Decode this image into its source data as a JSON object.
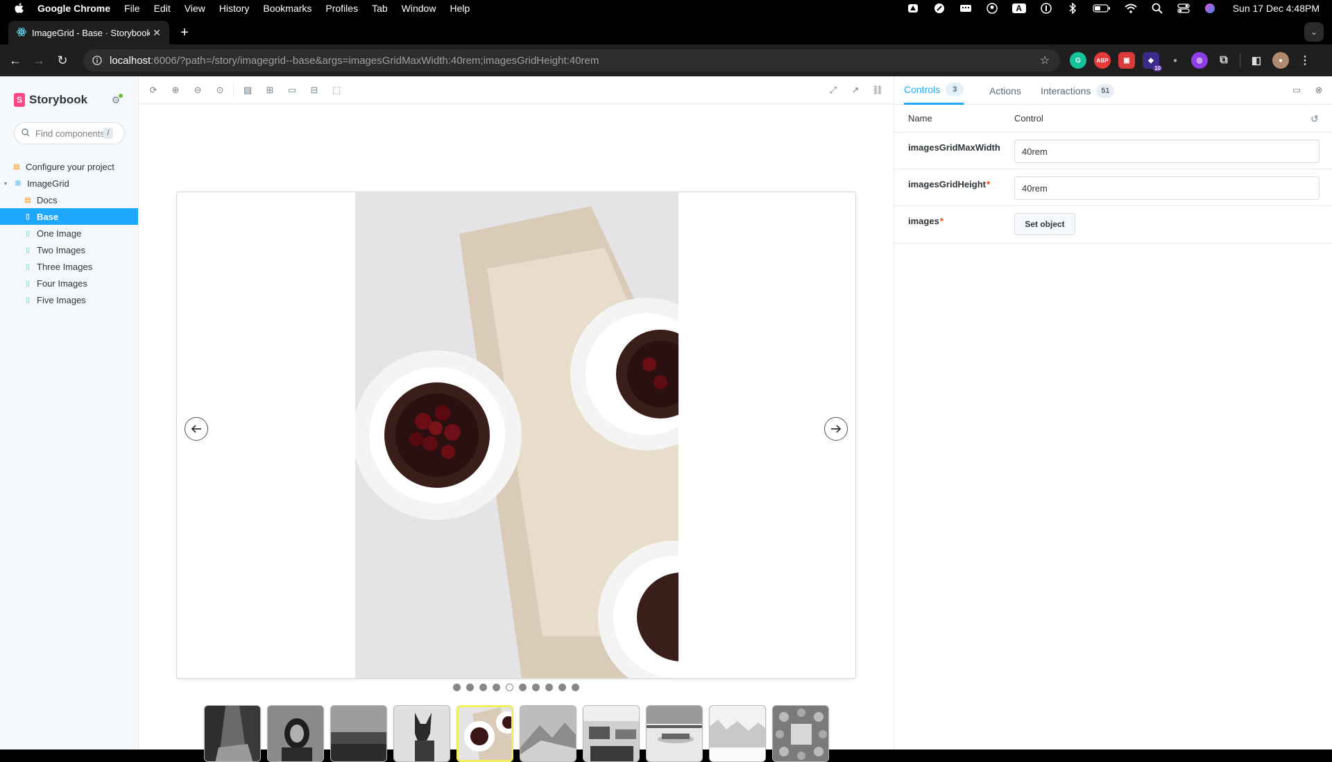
{
  "menubar": {
    "app_name": "Google Chrome",
    "menus": [
      "File",
      "Edit",
      "View",
      "History",
      "Bookmarks",
      "Profiles",
      "Tab",
      "Window",
      "Help"
    ],
    "clock": "Sun 17 Dec  4:48PM",
    "status_icons": [
      "drive-icon",
      "grammarly-icon",
      "keyboard-brightness-icon",
      "user-circle-icon",
      "input-source-icon",
      "one-password-icon",
      "bluetooth-icon",
      "battery-icon",
      "wifi-icon",
      "spotlight-icon",
      "control-center-icon",
      "siri-icon"
    ]
  },
  "browser": {
    "tab_title": "ImageGrid - Base · Storybook",
    "url_host": "localhost",
    "url_rest": ":6006/?path=/story/imagegrid--base&args=imagesGridMaxWidth:40rem;imagesGridHeight:40rem",
    "extensions": [
      {
        "name": "grammarly",
        "label": "G",
        "color": "#15c39a"
      },
      {
        "name": "adblock-plus",
        "label": "ABP",
        "color": "#e63a3a"
      },
      {
        "name": "toolbox",
        "label": "■",
        "color": "#d93a3a"
      },
      {
        "name": "extension-purple",
        "label": "10",
        "color": "#5b2fb0"
      },
      {
        "name": "pin",
        "label": "•",
        "color": "#777777"
      },
      {
        "name": "extension-violet",
        "label": "◎",
        "color": "#8e3fe6"
      }
    ]
  },
  "sidebar": {
    "brand": "Storybook",
    "search_placeholder": "Find components",
    "search_shortcut": "/",
    "items": [
      {
        "label": "Configure your project",
        "type": "doc",
        "indent": 0
      },
      {
        "label": "ImageGrid",
        "type": "component",
        "indent": 0
      },
      {
        "label": "Docs",
        "type": "doc",
        "indent": 1
      },
      {
        "label": "Base",
        "type": "story",
        "indent": 1,
        "selected": true
      },
      {
        "label": "One Image",
        "type": "story",
        "indent": 1
      },
      {
        "label": "Two Images",
        "type": "story",
        "indent": 1
      },
      {
        "label": "Three Images",
        "type": "story",
        "indent": 1
      },
      {
        "label": "Four Images",
        "type": "story",
        "indent": 1
      },
      {
        "label": "Five Images",
        "type": "story",
        "indent": 1
      }
    ]
  },
  "canvas_toolbar": {
    "left_icons": [
      "remount-icon",
      "zoom-in-icon",
      "zoom-out-icon",
      "zoom-reset-icon",
      "background-icon",
      "grid-icon",
      "viewport-icon",
      "measure-icon",
      "outline-icon"
    ],
    "right_icons": [
      "fullscreen-icon",
      "open-new-tab-icon",
      "copy-link-icon"
    ]
  },
  "preview": {
    "dot_count": 10,
    "active_dot": 4,
    "thumbnail_count": 10,
    "active_thumbnail": 4,
    "thumbnails": [
      "canyon",
      "portrait",
      "field",
      "dog",
      "cherry-cake",
      "mountains",
      "office",
      "car-showroom",
      "snowy-forest",
      "table-top"
    ]
  },
  "panel": {
    "tabs": [
      {
        "label": "Controls",
        "badge": "3",
        "active": true
      },
      {
        "label": "Actions",
        "badge": "",
        "active": false
      },
      {
        "label": "Interactions",
        "badge": "51",
        "active": false
      }
    ],
    "header": {
      "name": "Name",
      "control": "Control"
    },
    "args": [
      {
        "name": "imagesGridMaxWidth",
        "required": false,
        "value": "40rem"
      },
      {
        "name": "imagesGridHeight",
        "required": true,
        "value": "40rem"
      },
      {
        "name": "images",
        "required": true,
        "button": "Set object"
      }
    ],
    "required_mark": "*"
  }
}
